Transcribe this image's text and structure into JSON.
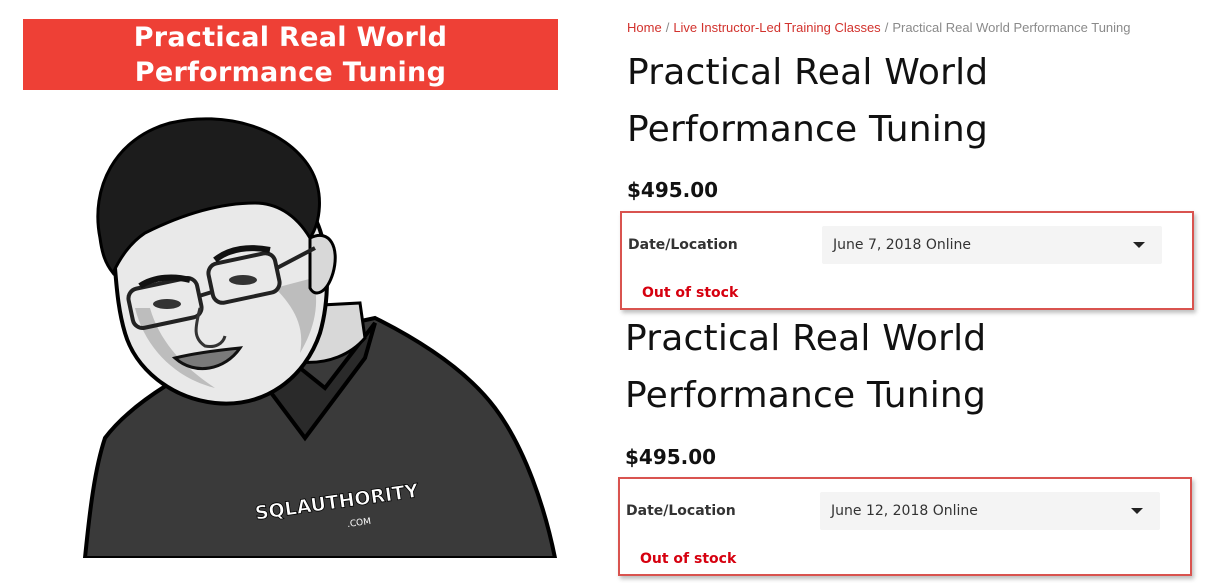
{
  "banner": {
    "line1": "Practical Real World",
    "line2": "Performance Tuning"
  },
  "illustration": {
    "logo_text": "SQLAUTHORITY",
    "logo_sub": ".COM"
  },
  "breadcrumb": {
    "home": "Home",
    "separator": "/",
    "category": "Live Instructor-Led Training Classes",
    "current": "Practical Real World Performance Tuning"
  },
  "products": [
    {
      "title_line1": "Practical Real World",
      "title_line2": "Performance Tuning",
      "price": "$495.00",
      "date_label": "Date/Location",
      "selected_option": "June 7, 2018 Online",
      "stock": "Out of stock"
    },
    {
      "title_line1": "Practical Real World",
      "title_line2": "Performance Tuning",
      "price": "$495.00",
      "date_label": "Date/Location",
      "selected_option": "June 12, 2018 Online",
      "stock": "Out of stock"
    }
  ],
  "colors": {
    "banner_bg": "#ee4036",
    "link": "#d2322d",
    "stock_red": "#d6000f",
    "highlight_border": "#d9534f",
    "select_bg": "#f4f4f4"
  }
}
